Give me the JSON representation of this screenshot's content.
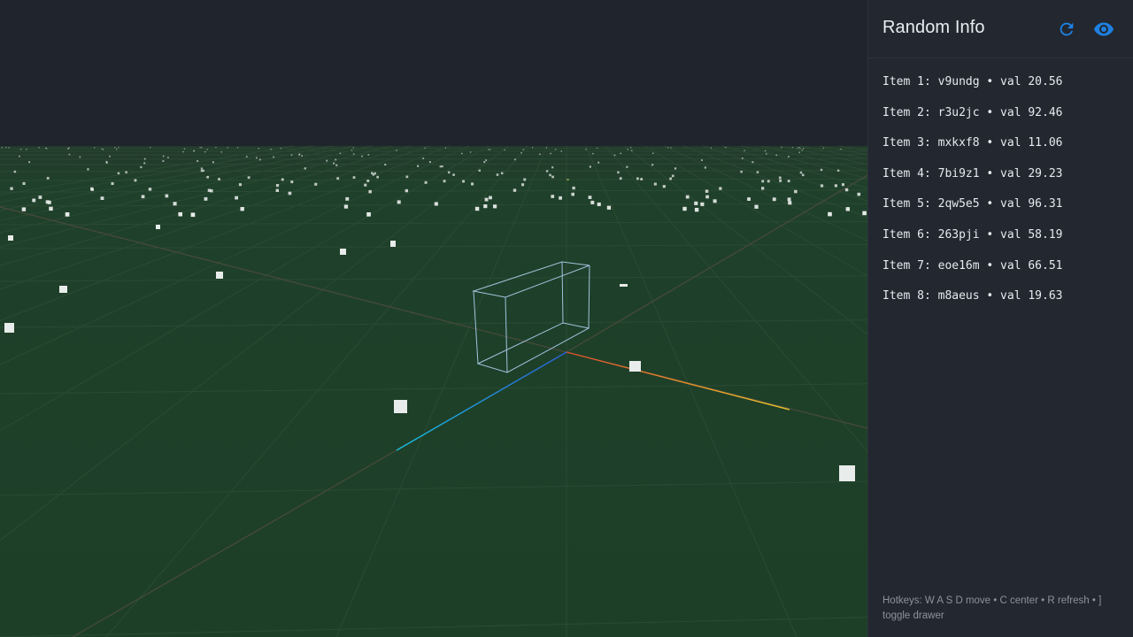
{
  "drawer": {
    "title": "Random Info",
    "refresh_icon": "refresh-icon",
    "visibility_icon": "eye-icon",
    "accent_color": "#1e80e0",
    "items": [
      "Item 1: v9undg • val 20.56",
      "Item 2: r3u2jc • val 92.46",
      "Item 3: mxkxf8 • val 11.06",
      "Item 4: 7bi9z1 • val 29.23",
      "Item 5: 2qw5e5 • val 96.31",
      "Item 6: 263pji • val 58.19",
      "Item 7: eoe16m • val 66.51",
      "Item 8: m8aeus • val 19.63"
    ],
    "footer": "Hotkeys: W A S D move • C center • R refresh • ] toggle drawer"
  },
  "scene": {
    "sky_color": "#20242c",
    "ground_color": "#1e3f29",
    "grid_color": "#324f3b",
    "axis_x_color": "#e6a12a",
    "axis_y_color": "#8fcf3a",
    "axis_z_color": "#1aa7d9",
    "box_color": "#a9cbe9",
    "particle_color": "#e8ecea"
  }
}
